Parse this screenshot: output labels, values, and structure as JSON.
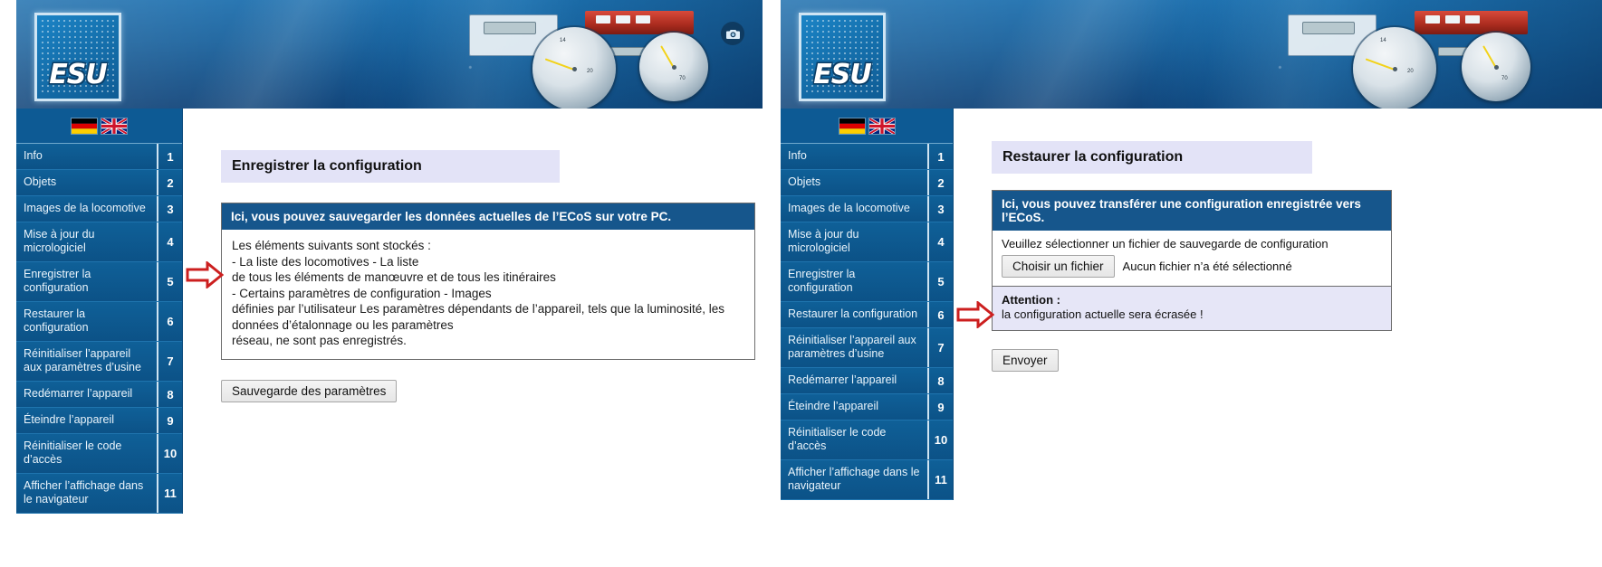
{
  "brand": {
    "logo_text": "ESU"
  },
  "flags": {
    "german": "german-flag",
    "english": "uk-flag"
  },
  "icons": {
    "camera": "camera-icon",
    "arrow": "red-arrow-icon"
  },
  "sidebar": {
    "items": [
      {
        "label": "Info",
        "num": "1"
      },
      {
        "label": "Objets",
        "num": "2"
      },
      {
        "label": "Images de la locomotive",
        "num": "3"
      },
      {
        "label": "Mise à jour du micrologiciel",
        "num": "4"
      },
      {
        "label": "Enregistrer la configuration",
        "num": "5"
      },
      {
        "label": "Restaurer la configuration",
        "num": "6"
      },
      {
        "label": "Réinitialiser l’appareil aux paramètres d’usine",
        "num": "7"
      },
      {
        "label": "Redémarrer l’appareil",
        "num": "8"
      },
      {
        "label": "Éteindre l’appareil",
        "num": "9"
      },
      {
        "label": "Réinitialiser le code d’accès",
        "num": "10"
      },
      {
        "label": "Afficher l’affichage dans le navigateur",
        "num": "11"
      }
    ]
  },
  "left_panel": {
    "page_title": "Enregistrer la configuration",
    "card_header": "Ici, vous pouvez sauvegarder les données actuelles de l’ECoS sur votre PC.",
    "body_lines": [
      "Les éléments suivants sont stockés :",
      "- La liste des locomotives - La liste",
      "de tous les éléments de manœuvre et de tous les itinéraires",
      "- Certains paramètres de configuration - Images",
      "définies par l’utilisateur Les paramètres dépendants de l’appareil, tels que la luminosité, les",
      "données d’étalonnage ou les paramètres",
      "réseau, ne sont pas enregistrés."
    ],
    "save_button": "Sauvegarde des paramètres"
  },
  "right_panel": {
    "page_title": "Restaurer la configuration",
    "card_header": "Ici, vous pouvez transférer une configuration enregistrée vers l’ECoS.",
    "file_hint": "Veuillez sélectionner un fichier de sauvegarde de configuration",
    "choose_file_button": "Choisir un fichier",
    "no_file_text": "Aucun fichier n’a été sélectionné",
    "warning_title": "Attention :",
    "warning_text": "la configuration actuelle sera écrasée !",
    "submit_button": "Envoyer"
  },
  "colors": {
    "brand_blue": "#0d5a94",
    "card_header_blue": "#16568c",
    "title_lavender": "#e3e3f7",
    "warning_lavender": "#e6e6f7",
    "arrow_red": "#cc1f1f"
  }
}
